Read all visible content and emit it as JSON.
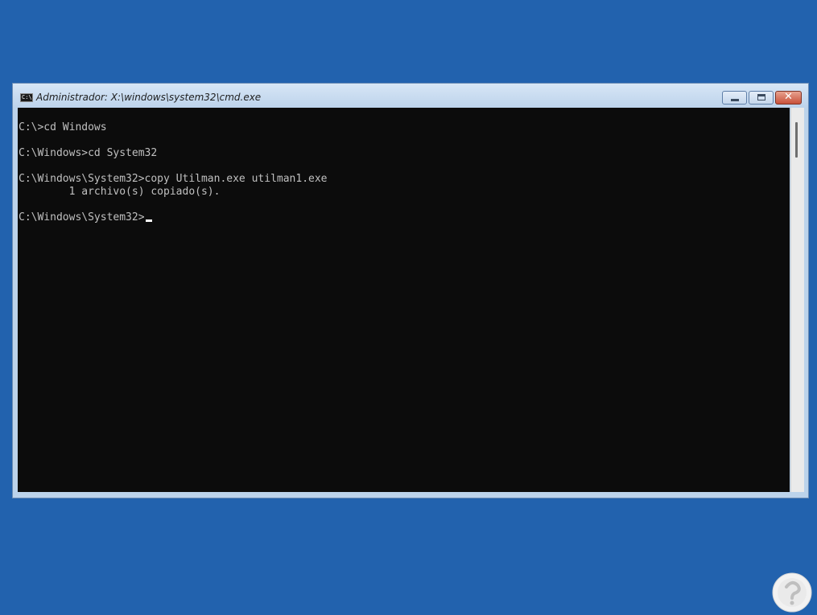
{
  "window": {
    "title": "Administrador: X:\\windows\\system32\\cmd.exe",
    "icon": "cmd-icon",
    "icon_text": "C:\\",
    "buttons": {
      "minimize_icon": "minimize-icon",
      "maximize_icon": "maximize-icon",
      "close_icon": "close-icon",
      "close_glyph": "✕"
    }
  },
  "console": {
    "lines": [
      "C:\\>cd Windows",
      "",
      "C:\\Windows>cd System32",
      "",
      "C:\\Windows\\System32>copy Utilman.exe utilman1.exe",
      "        1 archivo(s) copiado(s).",
      "",
      ""
    ],
    "prompt": "C:\\Windows\\System32>"
  },
  "colors": {
    "desktop": "#2262ae",
    "console_background": "#0c0c0c",
    "console_text": "#c0c0c0"
  }
}
